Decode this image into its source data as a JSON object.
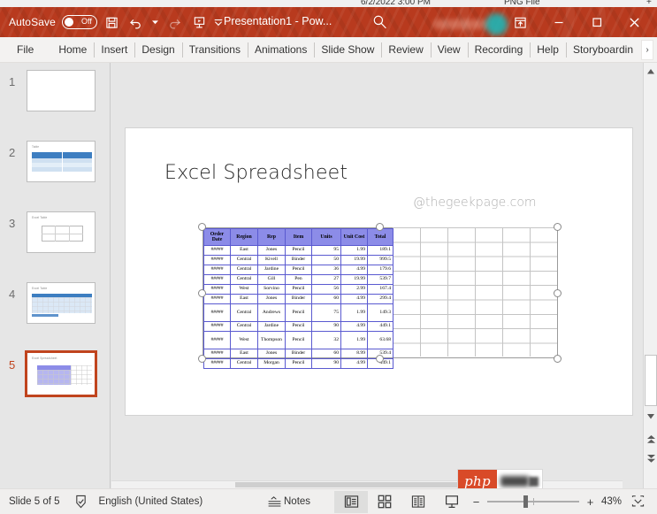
{
  "top_strip": {
    "date": "6/2/2022 3:00 PM",
    "file_type": "PNG File",
    "right_fragment": "+"
  },
  "titlebar": {
    "autosave_label": "AutoSave",
    "autosave_state": "Off",
    "document_title": "Presentation1  -  Pow...",
    "quick_access": [
      {
        "name": "save-icon",
        "label": "Save"
      },
      {
        "name": "undo-icon",
        "label": "Undo"
      },
      {
        "name": "undo-dropdown-icon",
        "label": "Undo options"
      },
      {
        "name": "redo-icon",
        "label": "Redo"
      },
      {
        "name": "start-presentation-icon",
        "label": "Start From Beginning"
      },
      {
        "name": "customize-qat-icon",
        "label": "Customize Quick Access Toolbar"
      }
    ],
    "window_controls": [
      {
        "name": "ribbon-display-options-icon",
        "label": "Ribbon Display Options"
      },
      {
        "name": "minimize-button",
        "label": "Minimize"
      },
      {
        "name": "maximize-button",
        "label": "Maximize"
      },
      {
        "name": "close-button",
        "label": "Close"
      }
    ],
    "search_label": "Search",
    "accent_color": "#b83a1e"
  },
  "ribbon": {
    "tabs": [
      "File",
      "Home",
      "Insert",
      "Design",
      "Transitions",
      "Animations",
      "Slide Show",
      "Review",
      "View",
      "Recording",
      "Help",
      "Storyboardin"
    ],
    "overflow_label": "›"
  },
  "thumbnails": [
    {
      "number": "1",
      "title": "",
      "selected": false
    },
    {
      "number": "2",
      "title": "Table",
      "selected": false
    },
    {
      "number": "3",
      "title": "Excel Table",
      "selected": false
    },
    {
      "number": "4",
      "title": "Excel Table",
      "selected": false
    },
    {
      "number": "5",
      "title": "Excel Spreadsheet",
      "selected": true
    }
  ],
  "slide": {
    "title": "Excel Spreadsheet",
    "watermark": "@thegeekpage.com"
  },
  "embedded_object": {
    "type": "excel-worksheet",
    "selected": true,
    "header_fill": "#8C8CE8",
    "border_color": "#5A5AD0",
    "columns": [
      "Order Date",
      "Region",
      "Rep",
      "Item",
      "Units",
      "Unit Cost",
      "Total"
    ],
    "rows": [
      [
        "#####",
        "East",
        "Jones",
        "Pencil",
        "95",
        "1.99",
        "189.1"
      ],
      [
        "#####",
        "Central",
        "Kivell",
        "Binder",
        "50",
        "19.99",
        "999.5"
      ],
      [
        "#####",
        "Central",
        "Jardine",
        "Pencil",
        "36",
        "4.99",
        "179.6"
      ],
      [
        "#####",
        "Central",
        "Gill",
        "Pen",
        "27",
        "19.99",
        "539.7"
      ],
      [
        "#####",
        "West",
        "Sorvino",
        "Pencil",
        "56",
        "2.99",
        "167.4"
      ],
      [
        "#####",
        "East",
        "Jones",
        "Binder",
        "60",
        "4.99",
        "299.4"
      ],
      [
        "#####",
        "Central",
        "Andrews",
        "Pencil",
        "75",
        "1.99",
        "149.3"
      ],
      [
        "#####",
        "Central",
        "Jardine",
        "Pencil",
        "90",
        "4.99",
        "449.1"
      ],
      [
        "#####",
        "West",
        "Thompson",
        "Pencil",
        "32",
        "1.99",
        "63.68"
      ],
      [
        "#####",
        "East",
        "Jones",
        "Binder",
        "60",
        "8.99",
        "539.4"
      ],
      [
        "#####",
        "Central",
        "Morgan",
        "Pencil",
        "90",
        "4.99",
        "449.1"
      ]
    ]
  },
  "watermark_logo": {
    "text": "php"
  },
  "statusbar": {
    "slide_indicator": "Slide 5 of 5",
    "accessibility_label": "Accessibility Checker",
    "language": "English (United States)",
    "notes_label": "Notes",
    "views": [
      {
        "name": "normal-view-button",
        "label": "Normal",
        "active": true
      },
      {
        "name": "slide-sorter-view-button",
        "label": "Slide Sorter",
        "active": false
      },
      {
        "name": "reading-view-button",
        "label": "Reading View",
        "active": false
      },
      {
        "name": "slide-show-button",
        "label": "Slide Show",
        "active": false
      }
    ],
    "zoom_out_label": "−",
    "zoom_in_label": "+",
    "zoom_percent": "43%",
    "fit_label": "Fit slide to current window"
  }
}
